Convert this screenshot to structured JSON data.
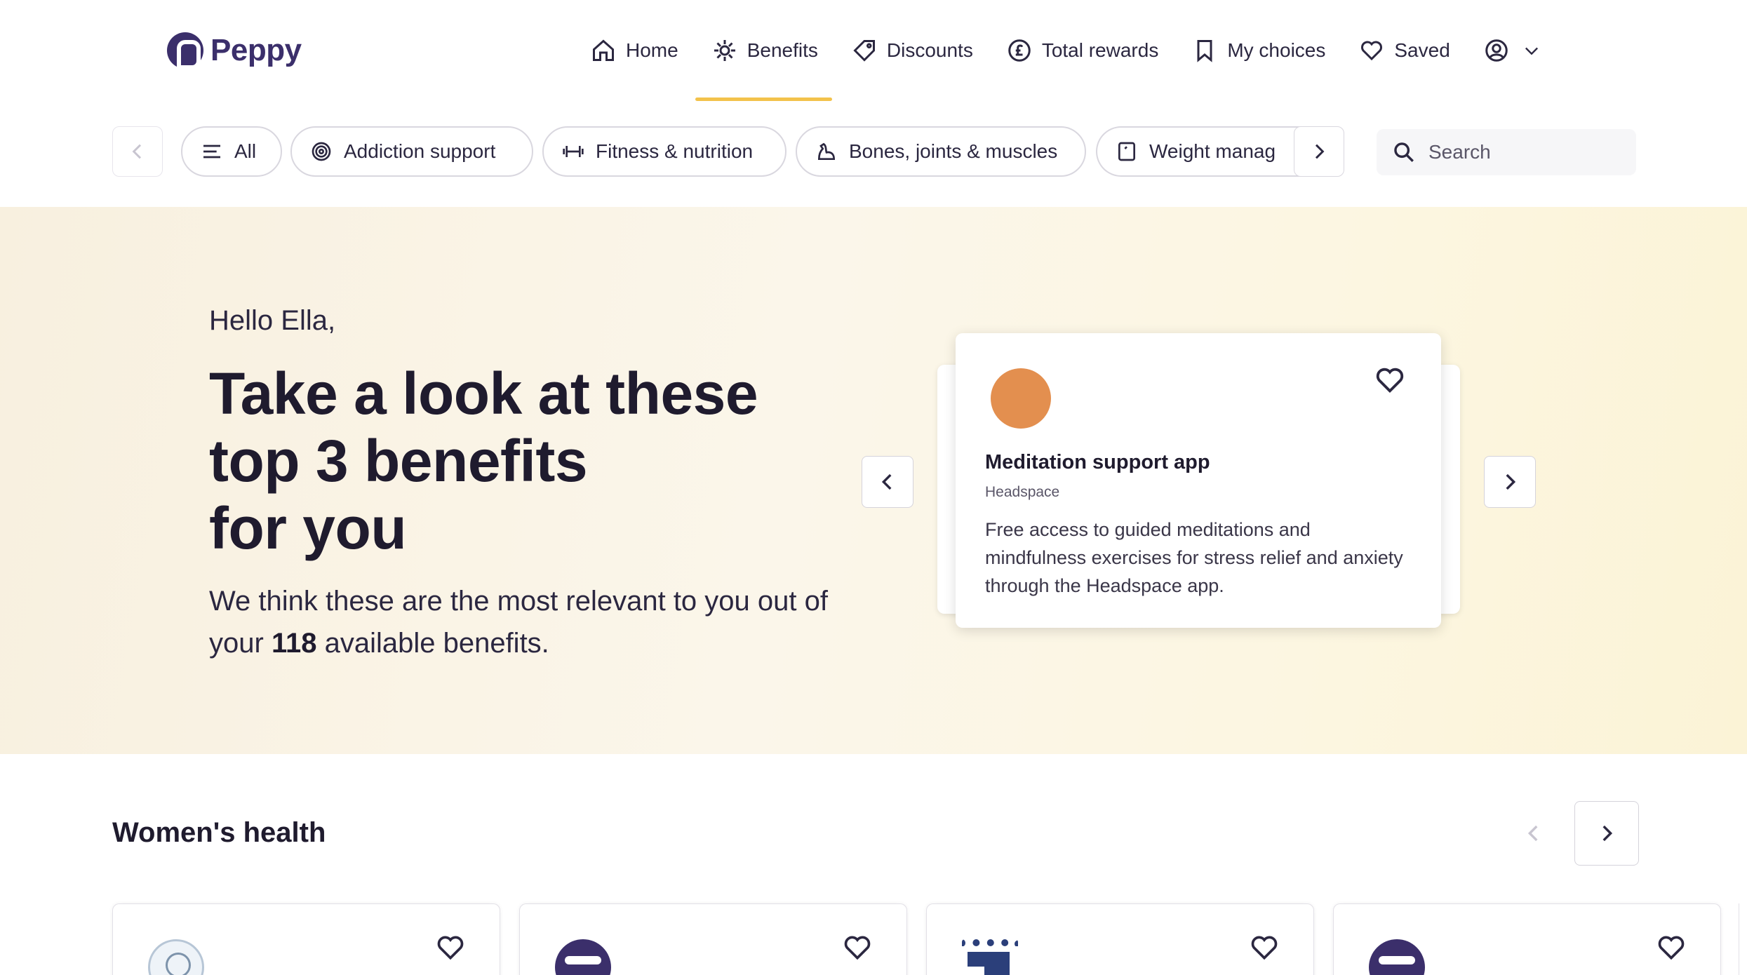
{
  "brand": {
    "name": "Peppy"
  },
  "nav": {
    "items": [
      {
        "label": "Home",
        "icon": "home-icon"
      },
      {
        "label": "Benefits",
        "icon": "sparkle-icon",
        "active": true
      },
      {
        "label": "Discounts",
        "icon": "tag-icon"
      },
      {
        "label": "Total rewards",
        "icon": "pound-coin-icon"
      },
      {
        "label": "My choices",
        "icon": "bookmark-icon"
      },
      {
        "label": "Saved",
        "icon": "heart-icon"
      }
    ],
    "account_icon": "user-circle-icon",
    "active_color": "#f3c24b"
  },
  "filters": {
    "chips": [
      {
        "label": "All",
        "icon": "list-icon"
      },
      {
        "label": "Addiction support",
        "icon": "target-icon"
      },
      {
        "label": "Fitness & nutrition",
        "icon": "dumbbell-icon"
      },
      {
        "label": "Bones, joints & muscles",
        "icon": "muscle-icon"
      },
      {
        "label": "Weight manag",
        "icon": "scale-icon"
      }
    ],
    "search": {
      "placeholder": "Search"
    }
  },
  "hero": {
    "greeting": "Hello Ella,",
    "headline_line1": "Take a look at these",
    "headline_line2": "top 3 benefits",
    "headline_line3": "for you",
    "sub_before": "We think these are the most relevant to you out of your ",
    "sub_count": "118",
    "sub_after": " available benefits.",
    "feature": {
      "title": "Meditation support app",
      "provider": "Headspace",
      "description": "Free access to guided meditations and mindfulness exercises for stress relief and anxiety through the Headspace app.",
      "logo_color": "#e38f4f"
    }
  },
  "section": {
    "title": "Women's health",
    "cards": [
      {
        "logo": "seal-logo"
      },
      {
        "logo": "peppy-logo"
      },
      {
        "logo": "flag-logo"
      },
      {
        "logo": "peppy-logo"
      }
    ]
  }
}
